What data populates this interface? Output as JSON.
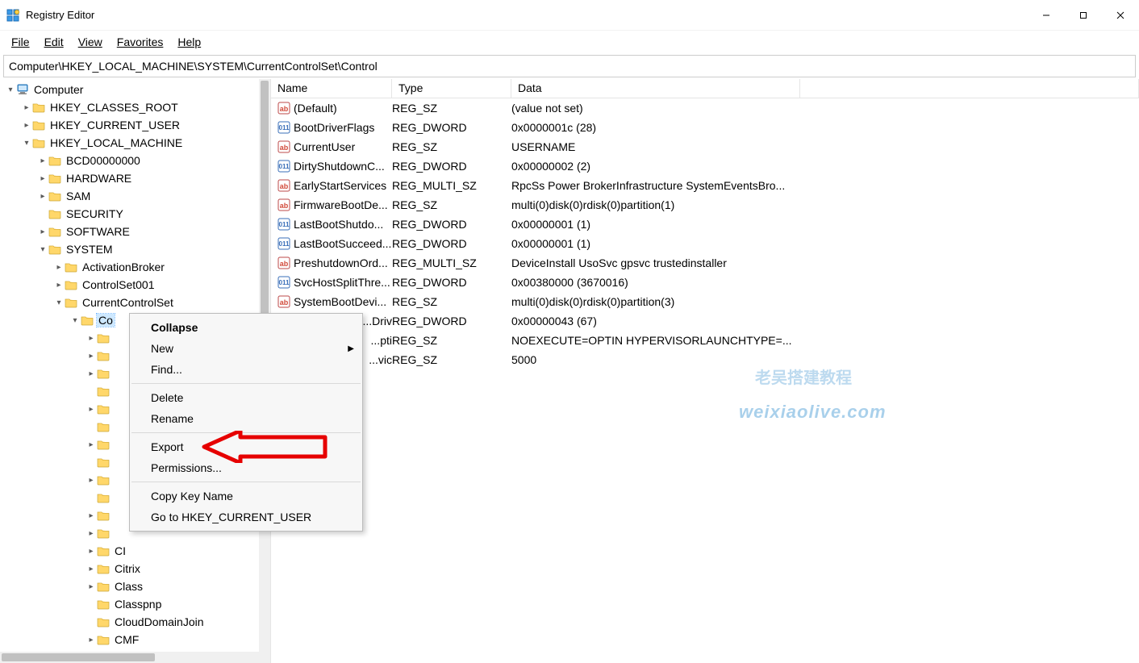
{
  "titlebar": {
    "caption": "Registry Editor"
  },
  "menubar": {
    "file": "File",
    "edit": "Edit",
    "view": "View",
    "favorites": "Favorites",
    "help": "Help"
  },
  "addressbar": {
    "path": "Computer\\HKEY_LOCAL_MACHINE\\SYSTEM\\CurrentControlSet\\Control"
  },
  "tree": {
    "root": "Computer",
    "nodes": [
      {
        "d": 1,
        "tw": ">",
        "l": "HKEY_CLASSES_ROOT"
      },
      {
        "d": 1,
        "tw": ">",
        "l": "HKEY_CURRENT_USER"
      },
      {
        "d": 1,
        "tw": "v",
        "l": "HKEY_LOCAL_MACHINE"
      },
      {
        "d": 2,
        "tw": ">",
        "l": "BCD00000000"
      },
      {
        "d": 2,
        "tw": ">",
        "l": "HARDWARE"
      },
      {
        "d": 2,
        "tw": ">",
        "l": "SAM"
      },
      {
        "d": 2,
        "tw": " ",
        "l": "SECURITY"
      },
      {
        "d": 2,
        "tw": ">",
        "l": "SOFTWARE"
      },
      {
        "d": 2,
        "tw": "v",
        "l": "SYSTEM"
      },
      {
        "d": 3,
        "tw": ">",
        "l": "ActivationBroker"
      },
      {
        "d": 3,
        "tw": ">",
        "l": "ControlSet001"
      },
      {
        "d": 3,
        "tw": "v",
        "l": "CurrentControlSet"
      },
      {
        "d": 4,
        "tw": "v",
        "l": "Co",
        "sel": true
      },
      {
        "d": 5,
        "tw": ">",
        "l": ""
      },
      {
        "d": 5,
        "tw": ">",
        "l": ""
      },
      {
        "d": 5,
        "tw": ">",
        "l": ""
      },
      {
        "d": 5,
        "tw": " ",
        "l": ""
      },
      {
        "d": 5,
        "tw": ">",
        "l": ""
      },
      {
        "d": 5,
        "tw": " ",
        "l": ""
      },
      {
        "d": 5,
        "tw": ">",
        "l": ""
      },
      {
        "d": 5,
        "tw": " ",
        "l": ""
      },
      {
        "d": 5,
        "tw": ">",
        "l": ""
      },
      {
        "d": 5,
        "tw": " ",
        "l": ""
      },
      {
        "d": 5,
        "tw": ">",
        "l": ""
      },
      {
        "d": 5,
        "tw": ">",
        "l": ""
      },
      {
        "d": 5,
        "tw": ">",
        "l": "CI"
      },
      {
        "d": 5,
        "tw": ">",
        "l": "Citrix"
      },
      {
        "d": 5,
        "tw": ">",
        "l": "Class"
      },
      {
        "d": 5,
        "tw": " ",
        "l": "Classpnp"
      },
      {
        "d": 5,
        "tw": " ",
        "l": "CloudDomainJoin"
      },
      {
        "d": 5,
        "tw": ">",
        "l": "CMF"
      }
    ]
  },
  "list": {
    "headers": {
      "name": "Name",
      "type": "Type",
      "data": "Data"
    },
    "rows": [
      {
        "k": "sz",
        "n": "(Default)",
        "t": "REG_SZ",
        "d": "(value not set)"
      },
      {
        "k": "dw",
        "n": "BootDriverFlags",
        "t": "REG_DWORD",
        "d": "0x0000001c (28)"
      },
      {
        "k": "sz",
        "n": "CurrentUser",
        "t": "REG_SZ",
        "d": "USERNAME"
      },
      {
        "k": "dw",
        "n": "DirtyShutdownC...",
        "t": "REG_DWORD",
        "d": "0x00000002 (2)"
      },
      {
        "k": "sz",
        "n": "EarlyStartServices",
        "t": "REG_MULTI_SZ",
        "d": "RpcSs Power BrokerInfrastructure SystemEventsBro..."
      },
      {
        "k": "sz",
        "n": "FirmwareBootDe...",
        "t": "REG_SZ",
        "d": "multi(0)disk(0)rdisk(0)partition(1)"
      },
      {
        "k": "dw",
        "n": "LastBootShutdo...",
        "t": "REG_DWORD",
        "d": "0x00000001 (1)"
      },
      {
        "k": "dw",
        "n": "LastBootSucceed...",
        "t": "REG_DWORD",
        "d": "0x00000001 (1)"
      },
      {
        "k": "sz",
        "n": "PreshutdownOrd...",
        "t": "REG_MULTI_SZ",
        "d": "DeviceInstall UsoSvc gpsvc trustedinstaller"
      },
      {
        "k": "dw",
        "n": "SvcHostSplitThre...",
        "t": "REG_DWORD",
        "d": "0x00380000 (3670016)"
      },
      {
        "k": "sz",
        "n": "SystemBootDevi...",
        "t": "REG_SZ",
        "d": "multi(0)disk(0)rdisk(0)partition(3)"
      },
      {
        "k": "dw",
        "n": "Driv...",
        "t": "REG_DWORD",
        "d": "0x00000043 (67)",
        "clip": true
      },
      {
        "k": "sz",
        "n": "pti...",
        "t": "REG_SZ",
        "d": "NOEXECUTE=OPTIN  HYPERVISORLAUNCHTYPE=...",
        "clip": true
      },
      {
        "k": "sz",
        "n": "vic...",
        "t": "REG_SZ",
        "d": "5000",
        "clip": true
      }
    ]
  },
  "ctxmenu": {
    "collapse": "Collapse",
    "new": "New",
    "find": "Find...",
    "delete": "Delete",
    "rename": "Rename",
    "export": "Export",
    "permissions": "Permissions...",
    "copykey": "Copy Key Name",
    "goto": "Go to HKEY_CURRENT_USER"
  },
  "watermark": {
    "line1": "老吴搭建教程",
    "line2": "weixiaolive.com"
  }
}
